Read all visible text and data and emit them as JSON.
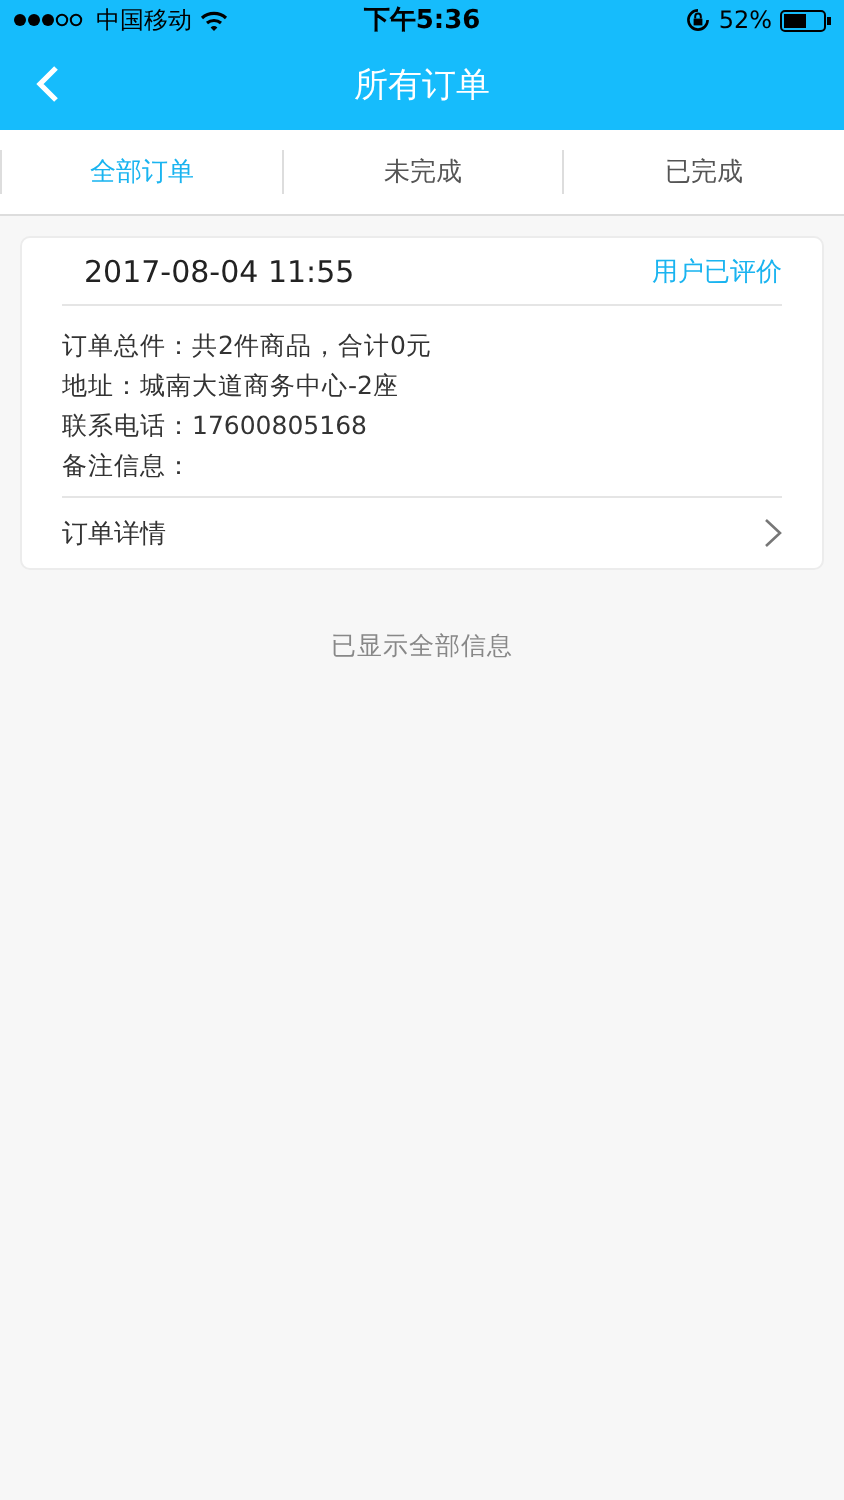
{
  "status_bar": {
    "carrier": "中国移动",
    "time": "下午5:36",
    "battery": "52%"
  },
  "nav": {
    "title": "所有订单"
  },
  "tabs": [
    {
      "label": "全部订单",
      "selected": true
    },
    {
      "label": "未完成",
      "selected": false
    },
    {
      "label": "已完成",
      "selected": false
    }
  ],
  "orders": [
    {
      "time": "2017-08-04 11:55",
      "status": "用户已评价",
      "lines": [
        "订单总件：共2件商品，合计0元",
        "地址：城南大道商务中心-2座",
        "联系电话：17600805168",
        "备注信息："
      ],
      "details": "订单详情"
    }
  ],
  "footer": "已显示全部信息"
}
